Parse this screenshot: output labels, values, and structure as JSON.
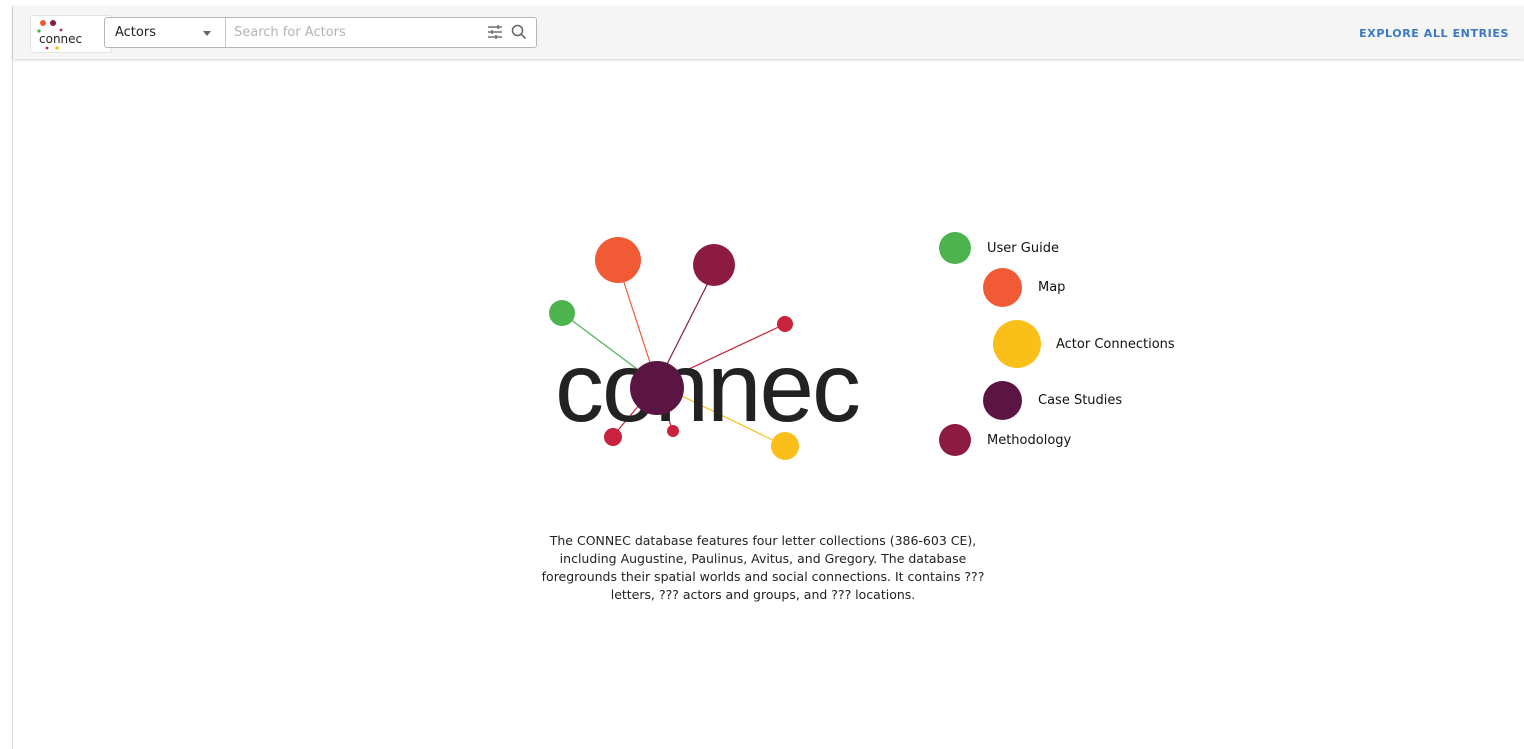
{
  "app": {
    "logo_text": "connec"
  },
  "search": {
    "category": "Actors",
    "placeholder": "Search for Actors",
    "filter_icon": "tune-icon",
    "search_icon": "search-icon"
  },
  "header": {
    "explore_label": "EXPLORE ALL ENTRIES"
  },
  "hero": {
    "wordmark": "connec"
  },
  "nav": [
    {
      "label": "User Guide",
      "color": "#4db34d"
    },
    {
      "label": "Map",
      "color": "#f05a35"
    },
    {
      "label": "Actor Connections",
      "color": "#fbbf1a"
    },
    {
      "label": "Case Studies",
      "color": "#5a1543"
    },
    {
      "label": "Methodology",
      "color": "#8c1a41"
    }
  ],
  "description": {
    "text": "The CONNEC database features four letter collections (386-603 CE), including Augustine, Paulinus, Avitus, and Gregory. The database foregrounds their spatial worlds and social connections. It contains ??? letters, ??? actors and groups, and ??? locations."
  },
  "colors": {
    "accent_link": "#3a78c4",
    "hub": "#5a1543",
    "orange": "#f05a35",
    "maroon": "#8c1a41",
    "green": "#4db34d",
    "red": "#c8223c",
    "yellow": "#fbbf1a"
  }
}
